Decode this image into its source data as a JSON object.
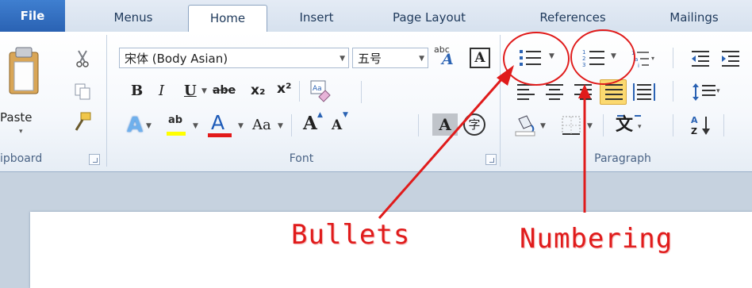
{
  "tabs": [
    "File",
    "Menus",
    "Home",
    "Insert",
    "Page Layout",
    "References",
    "Mailings"
  ],
  "clipboard": {
    "paste_label": "Paste",
    "group_label": "ipboard"
  },
  "font": {
    "family": "宋体 (Body Asian)",
    "size": "五号",
    "bold": "B",
    "italic": "I",
    "underline": "U",
    "strike": "abe",
    "subscript": "x₂",
    "superscript": "x²",
    "case": "Aa",
    "grow": "A",
    "shrink": "A",
    "shade": "A",
    "enclose": "字",
    "abc_label": "abc",
    "group_label": "Font"
  },
  "paragraph": {
    "group_label": "Paragraph"
  },
  "annotations": {
    "bullets": "Bullets",
    "numbering": "Numbering"
  },
  "colors": {
    "file_tab": "#2a62b3",
    "font_color_bar": "#e21a1a",
    "highlight_bar": "#ffff00",
    "annotation": "#e01b1b",
    "active_button": "#f9d46a"
  }
}
